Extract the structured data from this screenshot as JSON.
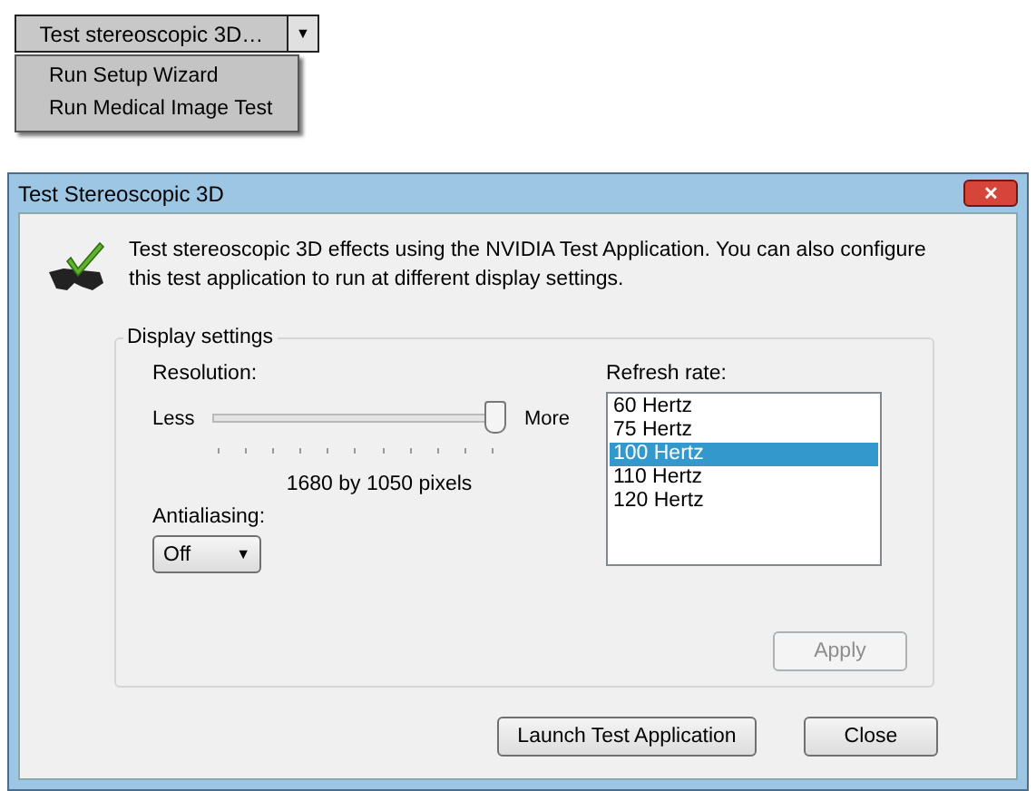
{
  "split_button": {
    "label": "Test stereoscopic 3D…",
    "arrow": "▼"
  },
  "menu": {
    "items": [
      {
        "label": "Run Setup Wizard"
      },
      {
        "label": "Run Medical Image Test"
      }
    ]
  },
  "window": {
    "title": "Test Stereoscopic 3D",
    "close": "✕"
  },
  "description": "Test stereoscopic 3D effects using the NVIDIA Test Application. You can also configure this test application to run at different display settings.",
  "display_settings": {
    "title": "Display settings",
    "resolution": {
      "label": "Resolution:",
      "min_label": "Less",
      "max_label": "More",
      "level": 0.97,
      "reading": "1680 by 1050 pixels"
    },
    "antialiasing": {
      "label": "Antialiasing:",
      "value": "Off",
      "arrow": "▼"
    },
    "refresh_rate": {
      "label": "Refresh rate:",
      "items": [
        {
          "label": "60 Hertz",
          "selected": false
        },
        {
          "label": "75 Hertz",
          "selected": false
        },
        {
          "label": "100 Hertz",
          "selected": true
        },
        {
          "label": "110 Hertz",
          "selected": false
        },
        {
          "label": "120 Hertz",
          "selected": false
        }
      ]
    },
    "apply": {
      "label": "Apply",
      "disabled": true
    }
  },
  "buttons": [
    {
      "label": "Launch Test Application"
    },
    {
      "label": "Close"
    }
  ]
}
